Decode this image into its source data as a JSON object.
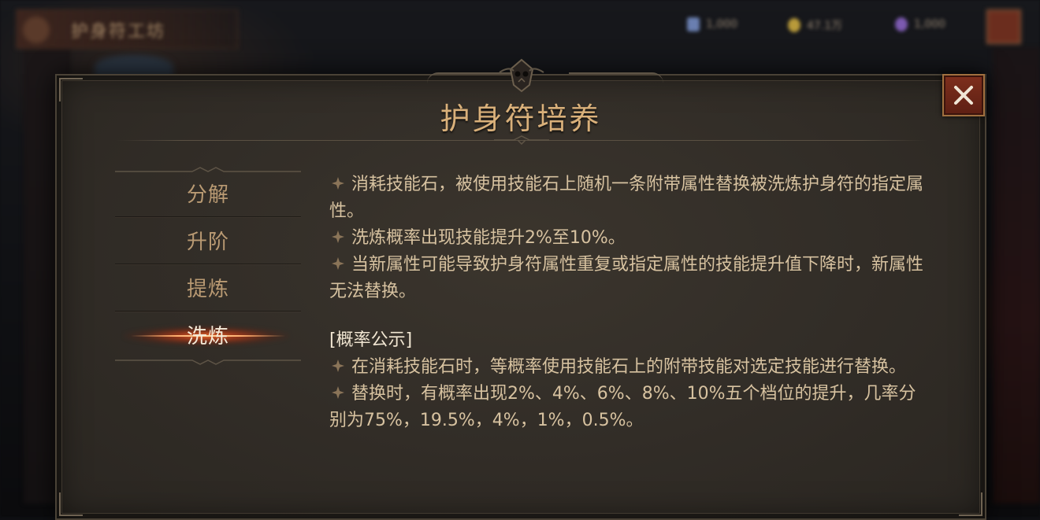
{
  "background": {
    "title": "护身符工坊",
    "currencies": [
      {
        "icon": "blue-crystal-icon",
        "value": "1,000",
        "color": "#6a7fb0"
      },
      {
        "icon": "gold-coin-icon",
        "value": "47.1万",
        "color": "#b89a3a"
      },
      {
        "icon": "purple-gem-icon",
        "value": "1,000",
        "color": "#7c5ab0"
      }
    ]
  },
  "dialog": {
    "title": "护身符培养",
    "close_icon": "close-icon"
  },
  "menu": {
    "items": [
      {
        "label": "分解",
        "active": false
      },
      {
        "label": "升阶",
        "active": false
      },
      {
        "label": "提炼",
        "active": false
      },
      {
        "label": "洗炼",
        "active": true
      }
    ]
  },
  "content": {
    "paragraphs": [
      "消耗技能石，被使用技能石上随机一条附带属性替换被洗炼护身符的指定属性。",
      "洗炼概率出现技能提升2%至10%。",
      "当新属性可能导致护身符属性重复或指定属性的技能提升值下降时，新属性无法替换。"
    ],
    "formula_heading": "[概率公示]",
    "formula_paragraphs": [
      "在消耗技能石时，等概率使用技能石上的附带技能对选定技能进行替换。",
      "替换时，有概率出现2%、4%、6%、8%、10%五个档位的提升，几率分别为75%，19.5%，4%，1%，0.5%。"
    ]
  },
  "colors": {
    "title": "#d9b07a",
    "menu_text": "#b99a73",
    "menu_active_text": "#f3ead8",
    "body_text": "#d7c2a0",
    "close_button": "#7e2f1d"
  }
}
